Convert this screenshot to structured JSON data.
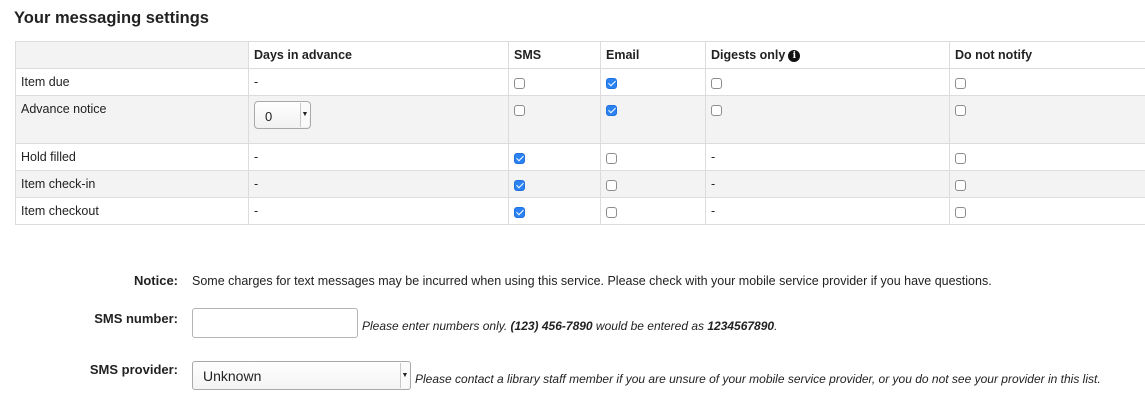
{
  "title": "Your messaging settings",
  "table": {
    "headers": [
      "",
      "Days in advance",
      "SMS",
      "Email",
      "Digests only",
      "Do not notify"
    ],
    "rows": [
      {
        "event": "Item due",
        "days": "-",
        "sms": false,
        "email": true,
        "digest": false,
        "digest_text": null,
        "donot": false
      },
      {
        "event": "Advance notice",
        "days_select": "0",
        "sms": false,
        "email": true,
        "digest": false,
        "digest_text": null,
        "donot": false
      },
      {
        "event": "Hold filled",
        "days": "-",
        "sms": true,
        "email": false,
        "digest": null,
        "digest_text": "-",
        "donot": false
      },
      {
        "event": "Item check-in",
        "days": "-",
        "sms": true,
        "email": false,
        "digest": null,
        "digest_text": "-",
        "donot": false
      },
      {
        "event": "Item checkout",
        "days": "-",
        "sms": true,
        "email": false,
        "digest": null,
        "digest_text": "-",
        "donot": false
      }
    ]
  },
  "notice": {
    "label": "Notice:",
    "text": "Some charges for text messages may be incurred when using this service. Please check with your mobile service provider if you have questions."
  },
  "sms_number": {
    "label": "SMS number:",
    "value": "",
    "hint_prefix": "Please enter numbers only. ",
    "hint_example": "(123) 456-7890",
    "hint_middle": " would be entered as ",
    "hint_result": "1234567890",
    "hint_suffix": "."
  },
  "sms_provider": {
    "label": "SMS provider:",
    "selected": "Unknown",
    "hint": "Please contact a library staff member if you are unsure of your mobile service provider, or you do not see your provider in this list."
  },
  "colors": {
    "checked": "#2b82f3",
    "row_alt": "#f3f3f3",
    "border": "#dcdcdc"
  }
}
